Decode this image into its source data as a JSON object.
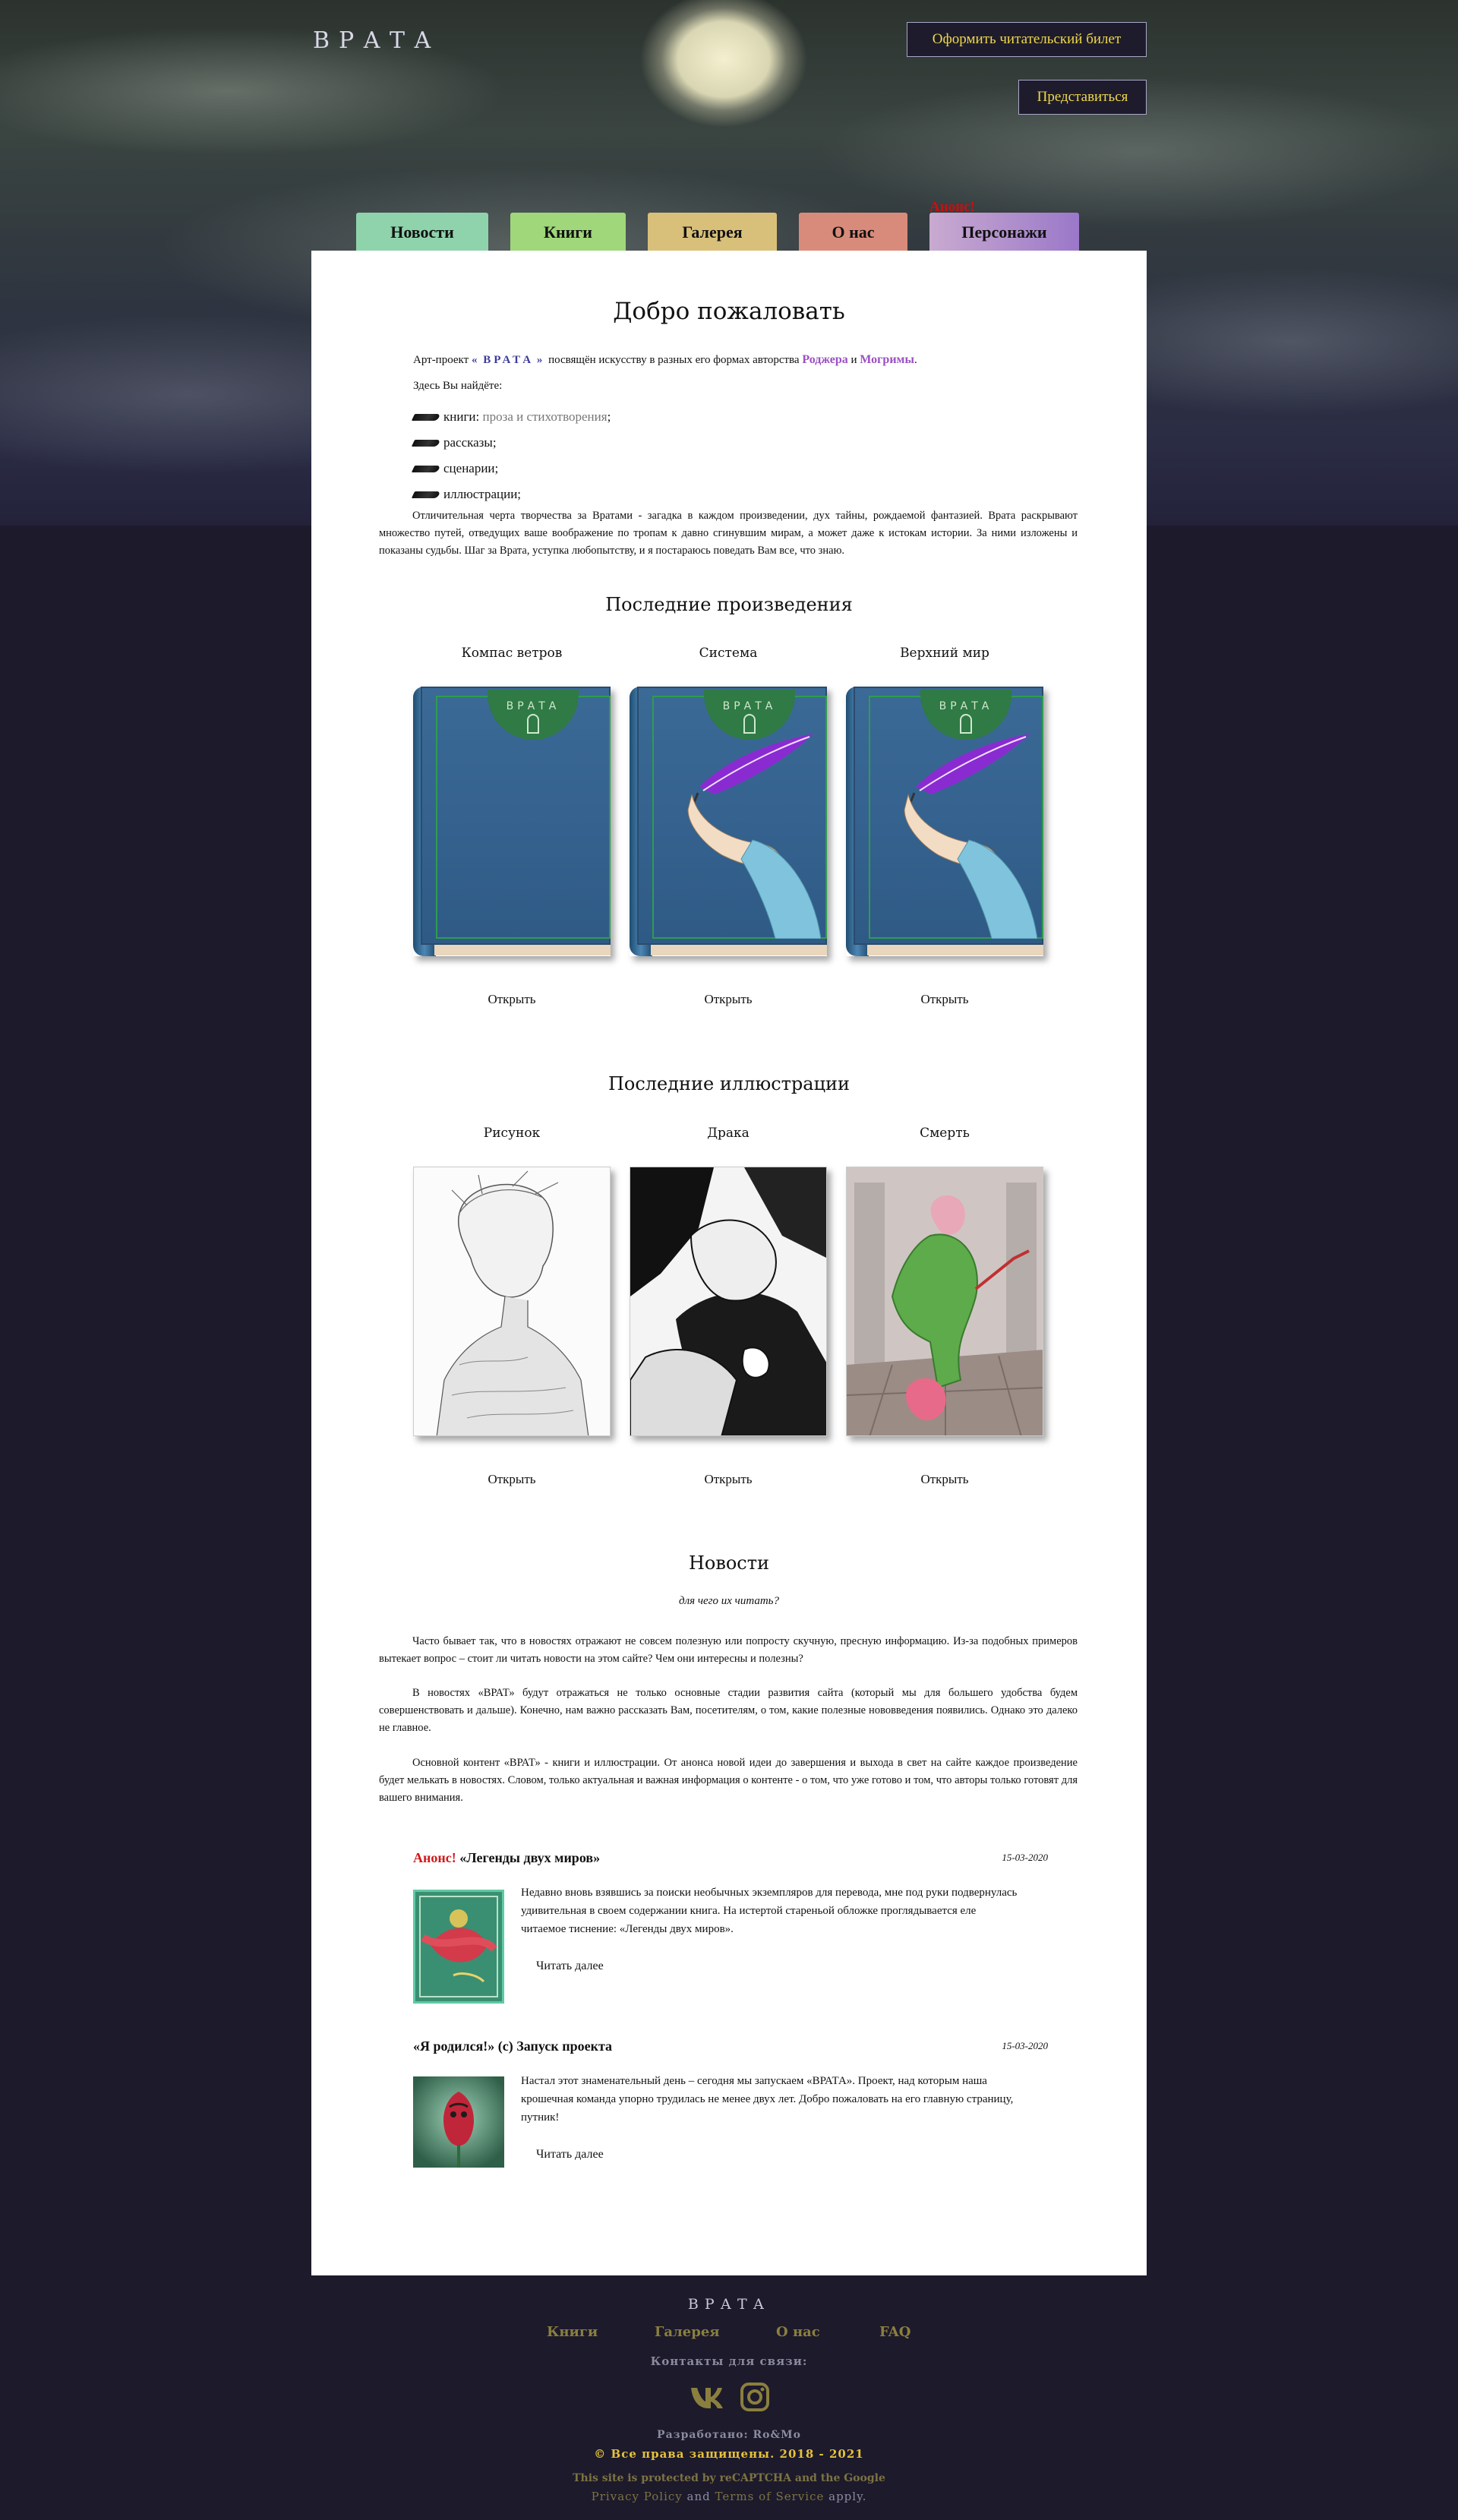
{
  "header": {
    "logo": "ВРАТА",
    "ticket_button": "Оформить читательский билет",
    "login_button": "Представиться"
  },
  "tabs": [
    {
      "label": "Новости",
      "color": "#8fd3ac"
    },
    {
      "label": "Книги",
      "color": "#9fd77a"
    },
    {
      "label": "Галерея",
      "color": "#d9c07a"
    },
    {
      "label": "О нас",
      "color": "#d98b7b"
    },
    {
      "label": "Персонажи",
      "color": "#9b78c9"
    }
  ],
  "announce_badge": "Анонс!",
  "welcome": {
    "title": "Добро пожаловать",
    "intro_prefix": "Арт-проект",
    "intro_quote_open": "«",
    "intro_name": "ВРАТА",
    "intro_quote_close": "»",
    "intro_middle": "посвящён искусству в разных его формах авторства",
    "author1": "Роджера",
    "intro_and": "и",
    "author2": "Могримы",
    "intro_end": ".",
    "find_here": "Здесь Вы найдёте:",
    "items": [
      {
        "label": "книги:",
        "extra": "проза и стихотворения",
        "suffix": ";"
      },
      {
        "label": "рассказы;"
      },
      {
        "label": "сценарии;"
      },
      {
        "label": "иллюстрации;"
      }
    ],
    "paragraph": "Отличительная черта творчества за Вратами - загадка в каждом произведении, дух тайны, рождаемой фантазией. Врата раскрывают множество путей, отведущих ваше воображение по тропам к давно сгинувшим мирам, а может даже к истокам истории. За ними изложены и показаны судьбы. Шаг за Врата, уступка любопытству, и я постараюсь поведать Вам все, что знаю."
  },
  "latest_works": {
    "title": "Последние произведения",
    "open_label": "Открыть",
    "items": [
      {
        "title": "Компас ветров",
        "cover_text": "ВРАТА"
      },
      {
        "title": "Система",
        "cover_text": "ВРАТА"
      },
      {
        "title": "Верхний мир",
        "cover_text": "ВРАТА"
      }
    ]
  },
  "latest_illustrations": {
    "title": "Последние иллюстрации",
    "open_label": "Открыть",
    "items": [
      {
        "title": "Рисунок"
      },
      {
        "title": "Драка"
      },
      {
        "title": "Смерть"
      }
    ]
  },
  "news": {
    "title": "Новости",
    "subtitle": "для чего их читать?",
    "paragraphs": [
      "Часто бывает так, что в новостях отражают не совсем полезную или попросту скучную, пресную информацию. Из-за подобных примеров вытекает вопрос – стоит ли читать новости на этом сайте? Чем они интересны и полезны?",
      "В новостях «ВРАТ» будут отражаться не только основные стадии развития сайта (который мы для большего удобства будем совершенствовать и дальше). Конечно, нам важно рассказать Вам, посетителям, о том, какие полезные нововведения появились. Однако это далеко не главное.",
      "Основной контент «ВРАТ» - книги и иллюстрации. От анонса новой идеи до завершения и выхода в свет на сайте каждое произведение будет мелькать в новостях. Словом, только актуальная и важная информация о контенте - о том, что уже готово и том, что авторы только готовят для вашего внимания."
    ],
    "read_more": "Читать далее",
    "items": [
      {
        "badge": "Анонс!",
        "title": "«Легенды двух миров»",
        "date": "15-03-2020",
        "text": "Недавно вновь взявшись за поиски необычных экземпляров для перевода, мне под руки подвернулась удивительная в своем содержании книга. На истертой стареньой обложке проглядывается еле читаемое тиснение: «Легенды двух миров»."
      },
      {
        "badge": "",
        "title": "«Я родился!» (с) Запуск проекта",
        "date": "15-03-2020",
        "text": "Настал этот знаменательный день – сегодня мы запускаем «ВРАТА». Проект, над которым наша крошечная команда упорно трудилась не менее двух лет. Добро пожаловать на его главную страницу, путник!"
      }
    ]
  },
  "footer": {
    "logo": "ВРАТА",
    "nav": [
      "Книги",
      "Галерея",
      "О нас",
      "FAQ"
    ],
    "contacts_label": "Контакты для связи:",
    "social": [
      "vk-icon",
      "instagram-icon"
    ],
    "developed": "Разработано: Ro&Mo",
    "copyright": "© Все права защищены. 2018 - 2021",
    "recaptcha_line1": "This site is protected by reCAPTCHA and the Google",
    "privacy": "Privacy Policy",
    "and": "and",
    "terms": "Terms of Service",
    "apply": "apply."
  },
  "colors": {
    "accent_yellow": "#f0d84a",
    "footer_gold": "#8a7f3e",
    "author_purple": "#9b4fc4",
    "announce_red": "#d01a1a"
  }
}
